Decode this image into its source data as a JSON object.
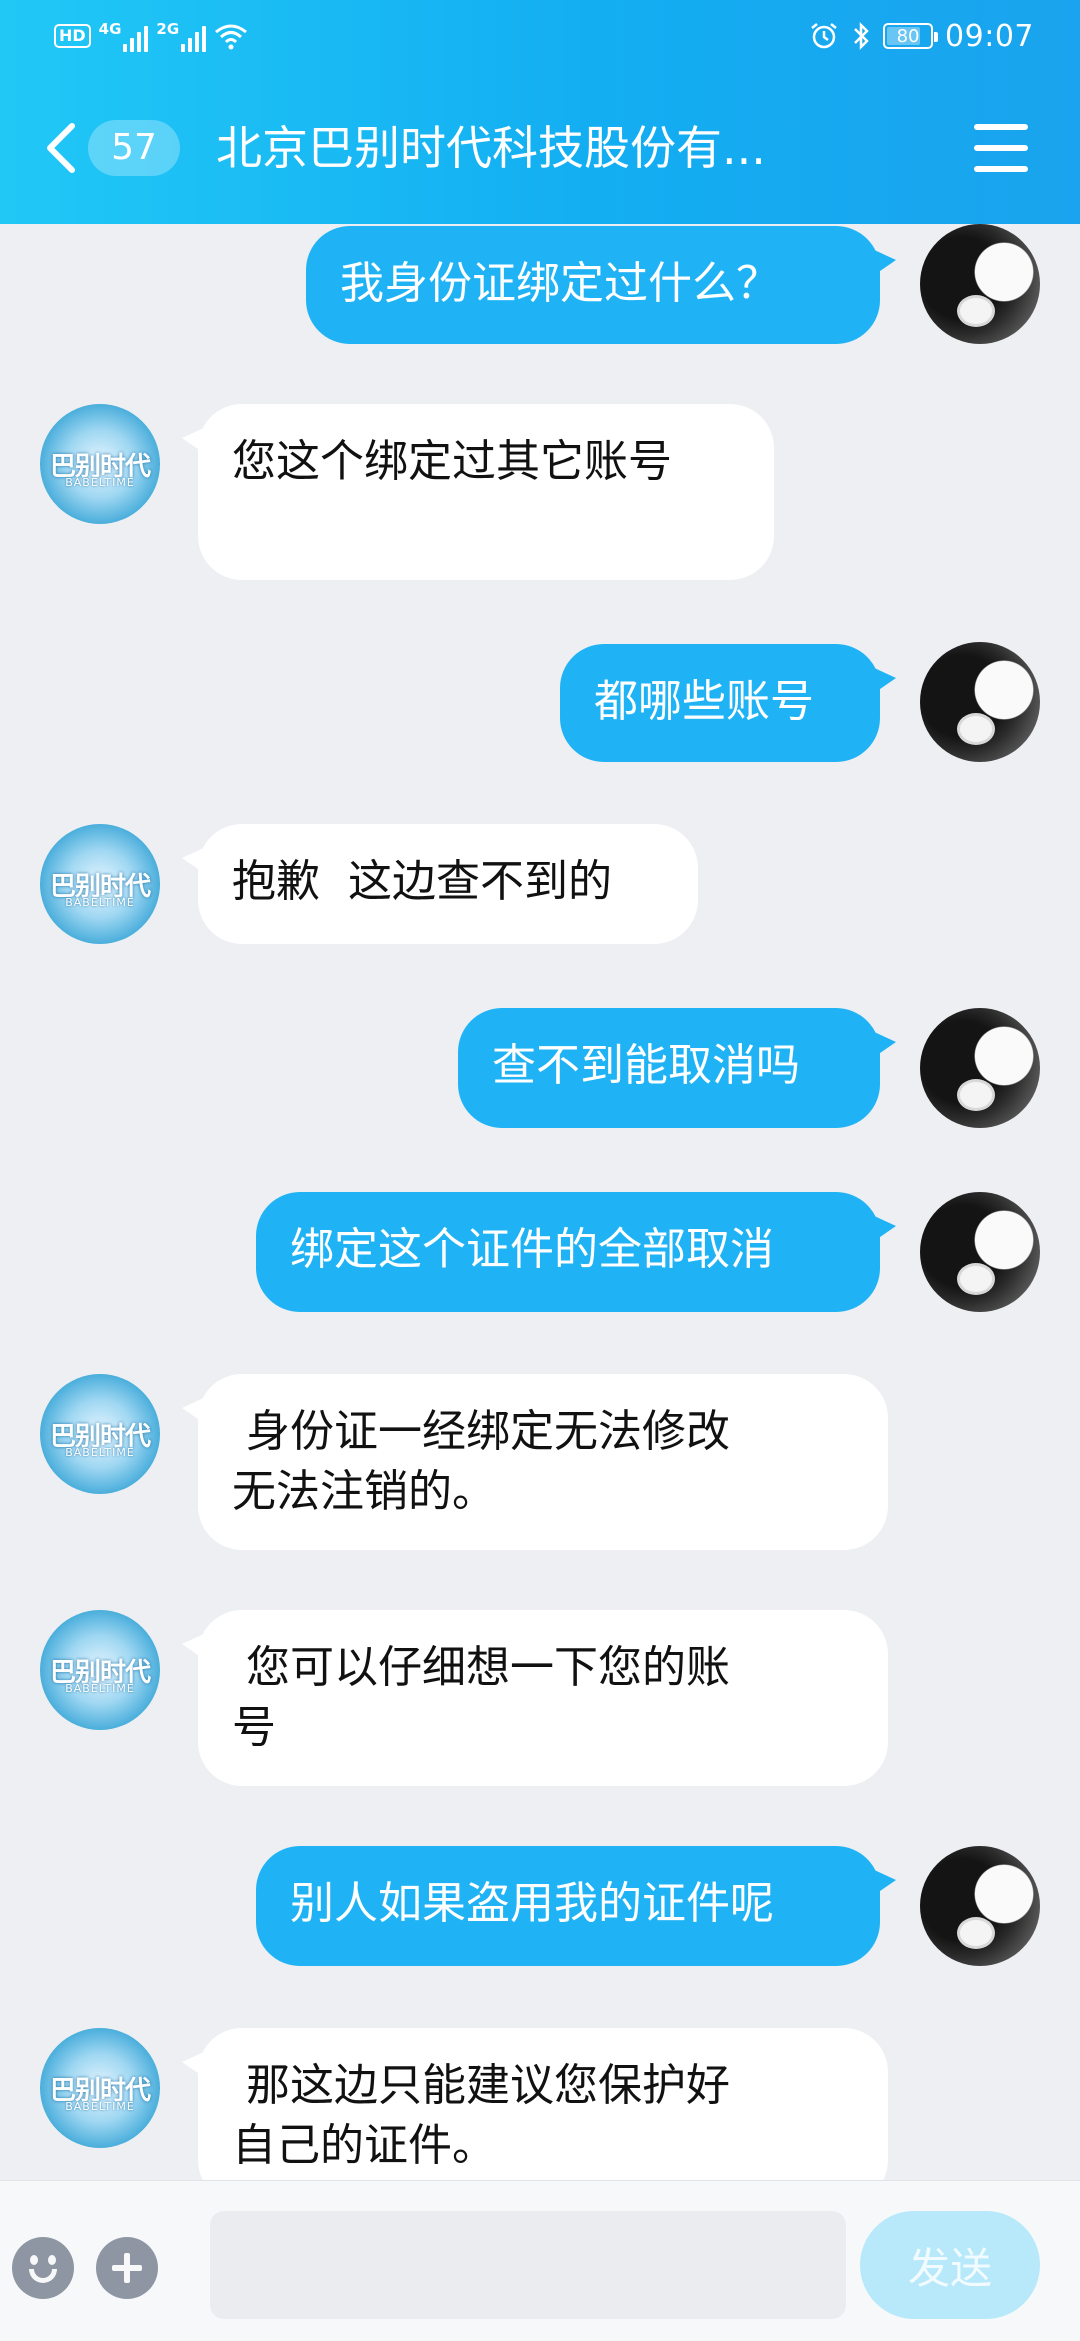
{
  "status_bar": {
    "hd_badge": "HD",
    "sim1_network": "4G",
    "sim2_network": "2G",
    "battery_level": "80",
    "time": "09:07",
    "icons": [
      "signal-icon",
      "wifi-icon",
      "alarm-icon",
      "bluetooth-icon",
      "battery-icon"
    ]
  },
  "header": {
    "unread_count": "57",
    "title": "北京巴别时代科技股份有..."
  },
  "bot_avatar": {
    "logo_text": "巴别时代",
    "logo_sub": "BABELTIME"
  },
  "messages": [
    {
      "sender": "user",
      "text": "我身份证绑定过什么？"
    },
    {
      "sender": "bot",
      "text": "您这个绑定过其它账号\n"
    },
    {
      "sender": "user",
      "text": "都哪些账号"
    },
    {
      "sender": "bot",
      "text": "抱歉  这边查不到的"
    },
    {
      "sender": "user",
      "text": "查不到能取消吗"
    },
    {
      "sender": "user",
      "text": "绑定这个证件的全部取消"
    },
    {
      "sender": "bot",
      "text": " 身份证一经绑定无法修改\n无法注销的。"
    },
    {
      "sender": "bot",
      "text": " 您可以仔细想一下您的账\n号"
    },
    {
      "sender": "user",
      "text": "别人如果盗用我的证件呢"
    },
    {
      "sender": "bot",
      "text": " 那这边只能建议您保护好\n自己的证件。"
    }
  ],
  "input_bar": {
    "input_value": "",
    "send_label": "发送"
  },
  "colors": {
    "header_gradient_start": "#21c8f6",
    "header_gradient_end": "#1aa3ee",
    "user_bubble": "#1fb3f5",
    "bot_bubble": "#ffffff",
    "background": "#edeff3",
    "send_button_disabled": "#b7e9fb"
  }
}
